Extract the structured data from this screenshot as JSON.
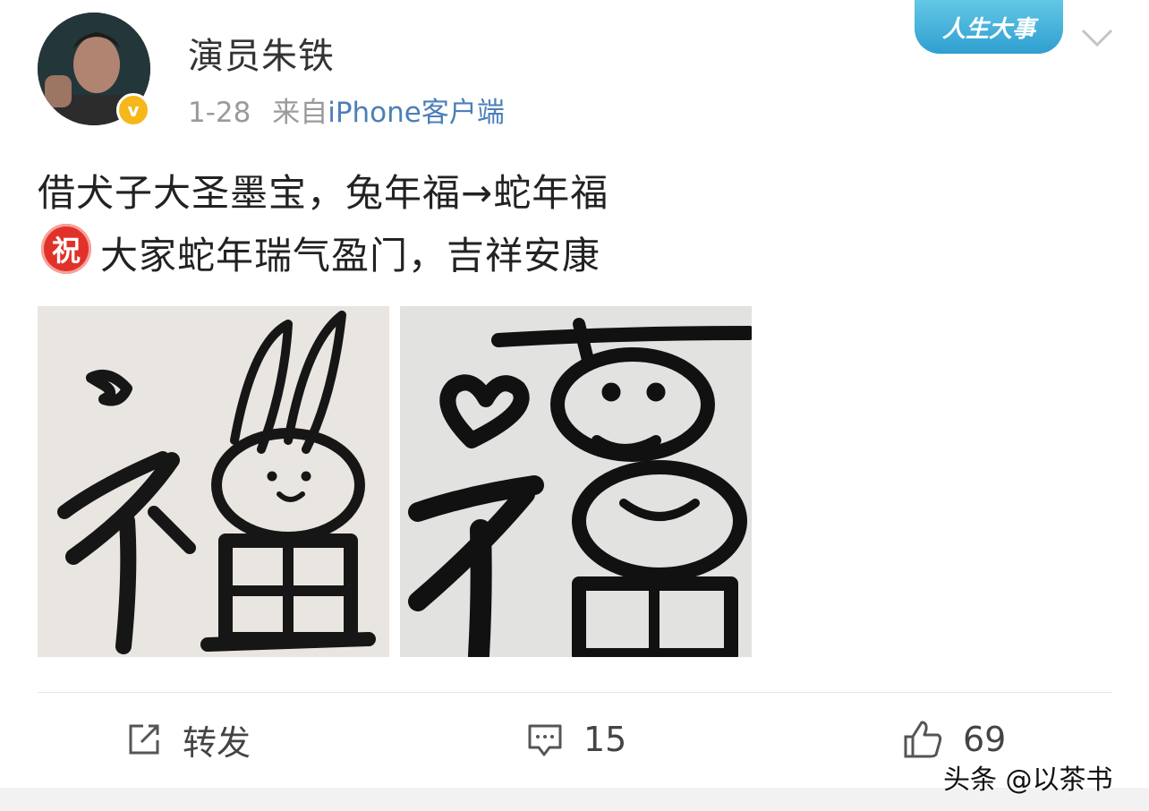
{
  "post": {
    "username": "演员朱铁",
    "date": "1-28",
    "from_label": "来自",
    "source": "iPhone客户端",
    "verified_badge": "v",
    "text_line1": "借犬子大圣墨宝，兔年福→蛇年福",
    "zhu_emoji": "祝",
    "text_line2": "大家蛇年瑞气盈门，吉祥安康"
  },
  "banner": {
    "label": "人生大事"
  },
  "actions": {
    "share_label": "转发",
    "comment_count": "15",
    "like_count": "69"
  },
  "watermark": "头条 @以茶书",
  "icons": {
    "share": "share-icon",
    "comment": "comment-icon",
    "like": "thumbs-up-icon",
    "more": "chevron-down-icon"
  }
}
